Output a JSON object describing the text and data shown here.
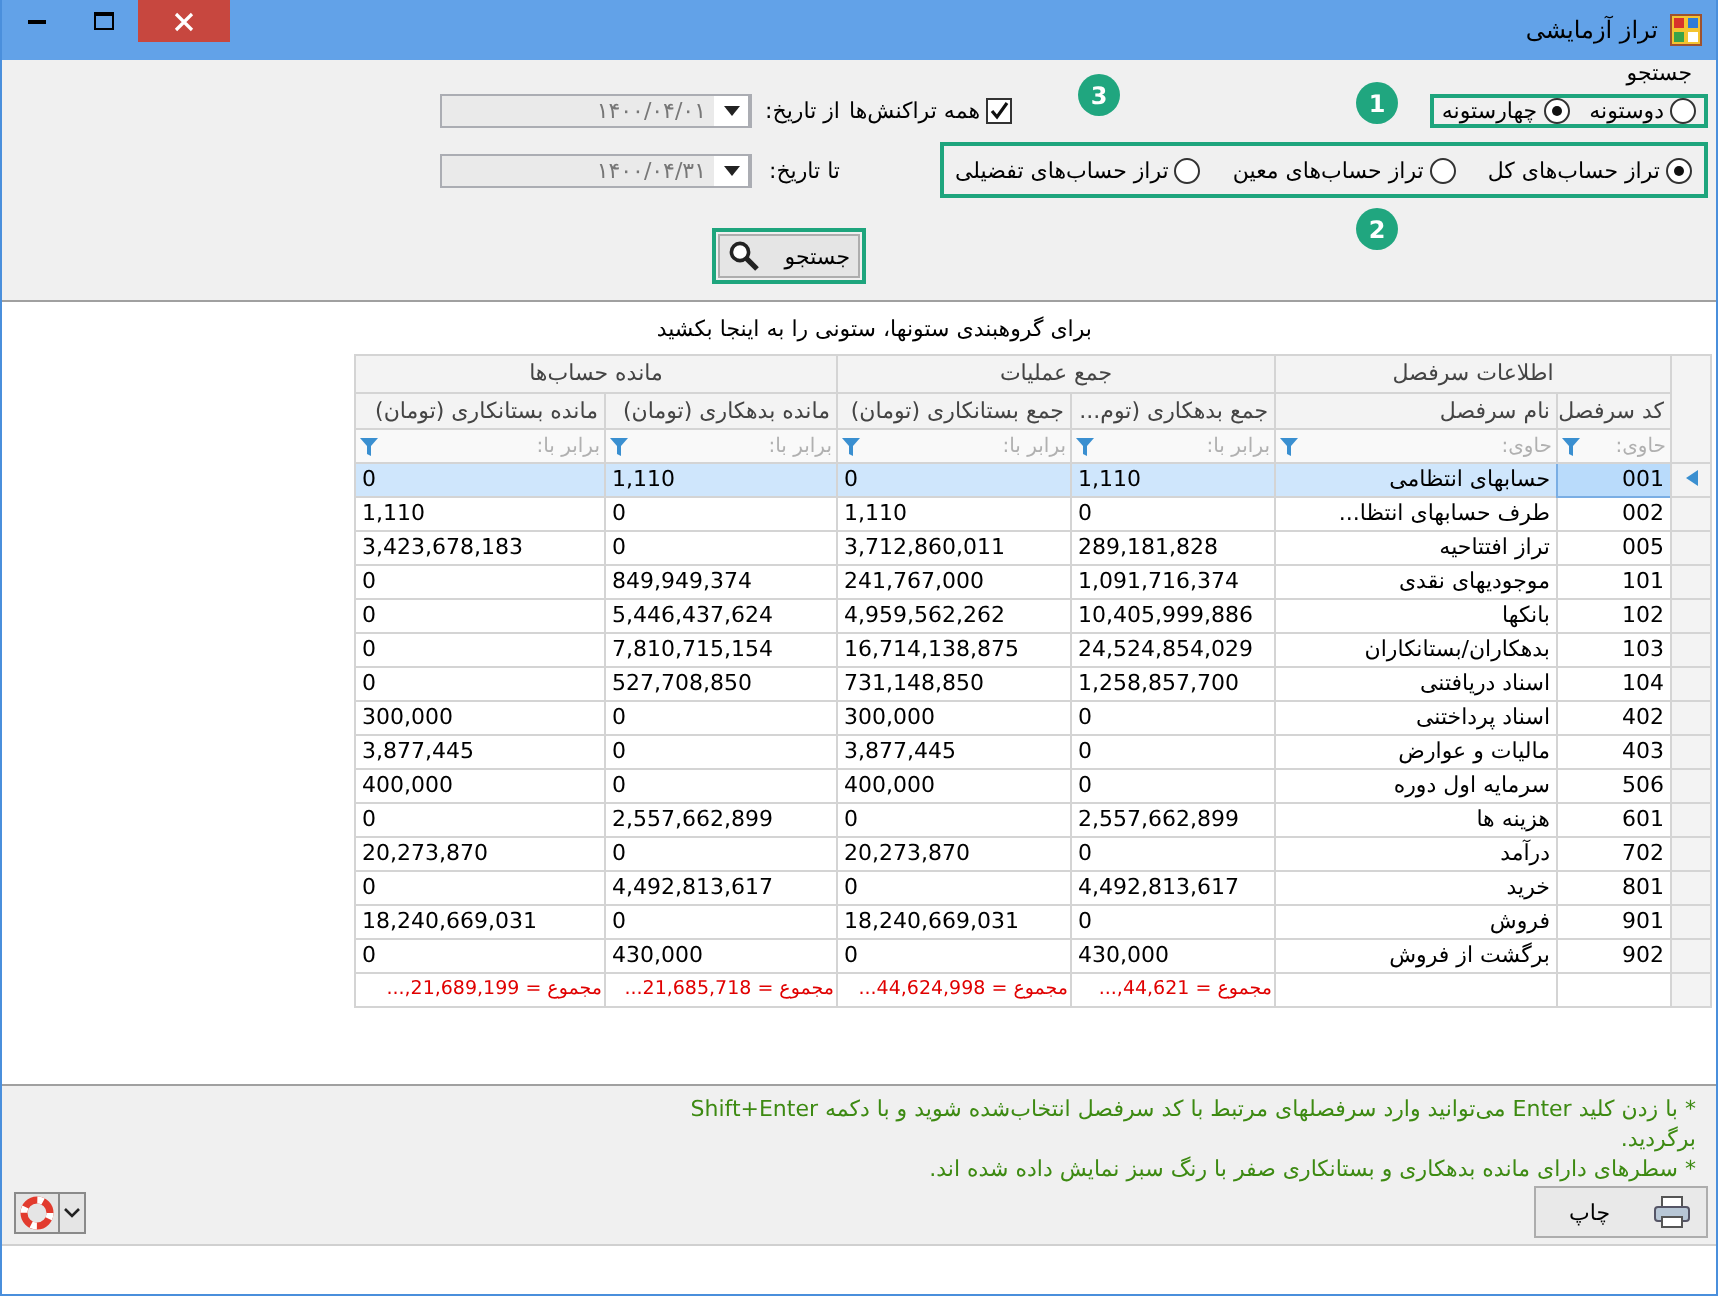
{
  "window": {
    "title": "تراز آزمایشی"
  },
  "search_group": {
    "title": "جستجو",
    "column_mode": [
      {
        "label": "دوستونه",
        "selected": false
      },
      {
        "label": "چهارستونه",
        "selected": true
      }
    ],
    "account_level": [
      {
        "label": "تراز حساب‌های کل",
        "selected": true
      },
      {
        "label": "تراز حساب‌های معین",
        "selected": false
      },
      {
        "label": "تراز حساب‌های تفضیلی",
        "selected": false
      }
    ],
    "all_transactions": {
      "label": "همه تراکنش‌ها",
      "checked": true
    },
    "from_date": {
      "label": "از تاریخ:",
      "value": "۱۴۰۰/۰۴/۰۱"
    },
    "to_date": {
      "label": "تا تاریخ:",
      "value": "۱۴۰۰/۰۴/۳۱"
    },
    "search_button": "جستجو"
  },
  "callouts": [
    "1",
    "2",
    "3"
  ],
  "grid": {
    "group_hint": "برای گروهبندی ستونها، ستونی را به اینجا بکشید",
    "bands": [
      "اطلاعات سرفصل",
      "جمع عملیات",
      "مانده حساب‌ها"
    ],
    "columns": [
      {
        "header": "کد سرفصل",
        "kind": "code",
        "placeholder": "حاوی:"
      },
      {
        "header": "نام سرفصل",
        "kind": "text",
        "placeholder": "حاوی:"
      },
      {
        "header": "جمع بدهکاری (توم...",
        "kind": "number",
        "placeholder": "برابر با:"
      },
      {
        "header": "جمع بستانکاری (تومان)",
        "kind": "number",
        "placeholder": "برابر با:"
      },
      {
        "header": "مانده بدهکاری (تومان)",
        "kind": "number",
        "placeholder": "برابر با:"
      },
      {
        "header": "مانده بستانکاری (تومان)",
        "kind": "number",
        "placeholder": "برابر با:"
      }
    ],
    "rows": [
      {
        "selected": true,
        "cells": [
          "001",
          "حسابهای انتظامی",
          "1,110",
          "0",
          "1,110",
          "0"
        ]
      },
      {
        "selected": false,
        "cells": [
          "002",
          "طرف حسابهای انتظا...",
          "0",
          "1,110",
          "0",
          "1,110"
        ]
      },
      {
        "selected": false,
        "cells": [
          "005",
          "تراز افتتاحیه",
          "289,181,828",
          "3,712,860,011",
          "0",
          "3,423,678,183"
        ]
      },
      {
        "selected": false,
        "cells": [
          "101",
          "موجودیهای نقدی",
          "1,091,716,374",
          "241,767,000",
          "849,949,374",
          "0"
        ]
      },
      {
        "selected": false,
        "cells": [
          "102",
          "بانکها",
          "10,405,999,886",
          "4,959,562,262",
          "5,446,437,624",
          "0"
        ]
      },
      {
        "selected": false,
        "cells": [
          "103",
          "بدهکاران/بستانکاران",
          "24,524,854,029",
          "16,714,138,875",
          "7,810,715,154",
          "0"
        ]
      },
      {
        "selected": false,
        "cells": [
          "104",
          "اسناد دریافتنی",
          "1,258,857,700",
          "731,148,850",
          "527,708,850",
          "0"
        ]
      },
      {
        "selected": false,
        "cells": [
          "402",
          "اسناد پرداختنی",
          "0",
          "300,000",
          "0",
          "300,000"
        ]
      },
      {
        "selected": false,
        "cells": [
          "403",
          "مالیات و عوارض",
          "0",
          "3,877,445",
          "0",
          "3,877,445"
        ]
      },
      {
        "selected": false,
        "cells": [
          "506",
          "سرمایه اول دوره",
          "0",
          "400,000",
          "0",
          "400,000"
        ]
      },
      {
        "selected": false,
        "cells": [
          "601",
          "هزینه ها",
          "2,557,662,899",
          "0",
          "2,557,662,899",
          "0"
        ]
      },
      {
        "selected": false,
        "cells": [
          "702",
          "درآمد",
          "0",
          "20,273,870",
          "0",
          "20,273,870"
        ]
      },
      {
        "selected": false,
        "cells": [
          "801",
          "خرید",
          "4,492,813,617",
          "0",
          "4,492,813,617",
          "0"
        ]
      },
      {
        "selected": false,
        "cells": [
          "901",
          "فروش",
          "0",
          "18,240,669,031",
          "0",
          "18,240,669,031"
        ]
      },
      {
        "selected": false,
        "cells": [
          "902",
          "برگشت از فروش",
          "430,000",
          "0",
          "430,000",
          "0"
        ]
      }
    ],
    "totals": [
      "مجموع = 44,621,...",
      "مجموع = 44,624,998...",
      "مجموع = 21,685,718...",
      "مجموع = 21,689,199,..."
    ]
  },
  "notes": [
    "* با زدن کلید Enter می‌توانید وارد سرفصلهای مرتبط با کد سرفصل انتخاب‌شده شوید و با دکمه Shift+Enter برگردید.",
    "* سطرهای دارای مانده بدهکاری و بستانکاری صفر با رنگ سبز نمایش داده شده اند."
  ],
  "print_button": "چاپ"
}
